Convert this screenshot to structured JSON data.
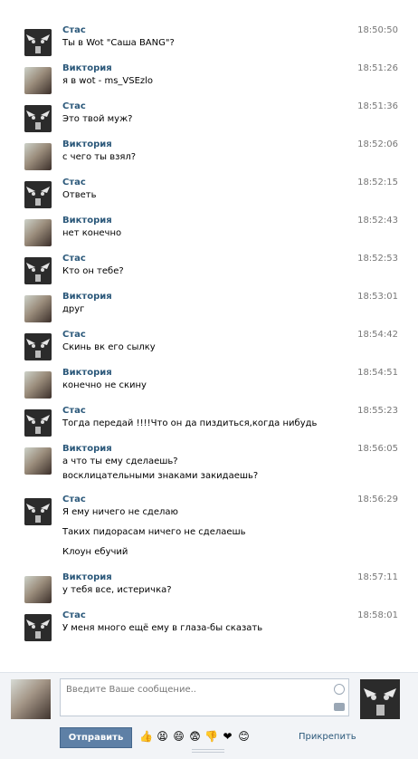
{
  "messages": [
    {
      "author": "Стас",
      "avatar": "stas",
      "time": "18:50:50",
      "lines": [
        "Ты в Wot \"Саша BANG\"?"
      ]
    },
    {
      "author": "Виктория",
      "avatar": "vika",
      "time": "18:51:26",
      "lines": [
        "я в wot - ms_VSEzlo"
      ]
    },
    {
      "author": "Стас",
      "avatar": "stas",
      "time": "18:51:36",
      "lines": [
        "Это твой муж?"
      ]
    },
    {
      "author": "Виктория",
      "avatar": "vika",
      "time": "18:52:06",
      "lines": [
        "с чего ты взял?"
      ]
    },
    {
      "author": "Стас",
      "avatar": "stas",
      "time": "18:52:15",
      "lines": [
        "Ответь"
      ]
    },
    {
      "author": "Виктория",
      "avatar": "vika",
      "time": "18:52:43",
      "lines": [
        "нет конечно"
      ]
    },
    {
      "author": "Стас",
      "avatar": "stas",
      "time": "18:52:53",
      "lines": [
        "Кто он тебе?"
      ]
    },
    {
      "author": "Виктория",
      "avatar": "vika",
      "time": "18:53:01",
      "lines": [
        "друг"
      ]
    },
    {
      "author": "Стас",
      "avatar": "stas",
      "time": "18:54:42",
      "lines": [
        "Скинь вк его сылку"
      ]
    },
    {
      "author": "Виктория",
      "avatar": "vika",
      "time": "18:54:51",
      "lines": [
        "конечно не скину"
      ]
    },
    {
      "author": "Стас",
      "avatar": "stas",
      "time": "18:55:23",
      "lines": [
        "Тогда передай !!!!Что он да пиздиться,когда нибудь"
      ]
    },
    {
      "author": "Виктория",
      "avatar": "vika",
      "time": "18:56:05",
      "lines": [
        "а что ты ему сделаешь?",
        "восклицательными знаками закидаешь?"
      ]
    },
    {
      "author": "Стас",
      "avatar": "stas",
      "time": "18:56:29",
      "lines": [
        "Я ему ничего не сделаю",
        "Таких пидорасам ничего не сделаешь",
        "Клоун ебучий"
      ]
    },
    {
      "author": "Виктория",
      "avatar": "vika",
      "time": "18:57:11",
      "lines": [
        "у тебя все, истеричка?"
      ]
    },
    {
      "author": "Стас",
      "avatar": "stas",
      "time": "18:58:01",
      "lines": [
        "У меня много ещё ему в глаза-бы сказать"
      ]
    }
  ],
  "composer": {
    "placeholder": "Введите Ваше сообщение..",
    "send_label": "Отправить",
    "attach_label": "Прикрепить",
    "emojis": [
      "👍",
      "😫",
      "😄",
      "😨",
      "👎",
      "❤",
      "😊"
    ]
  }
}
